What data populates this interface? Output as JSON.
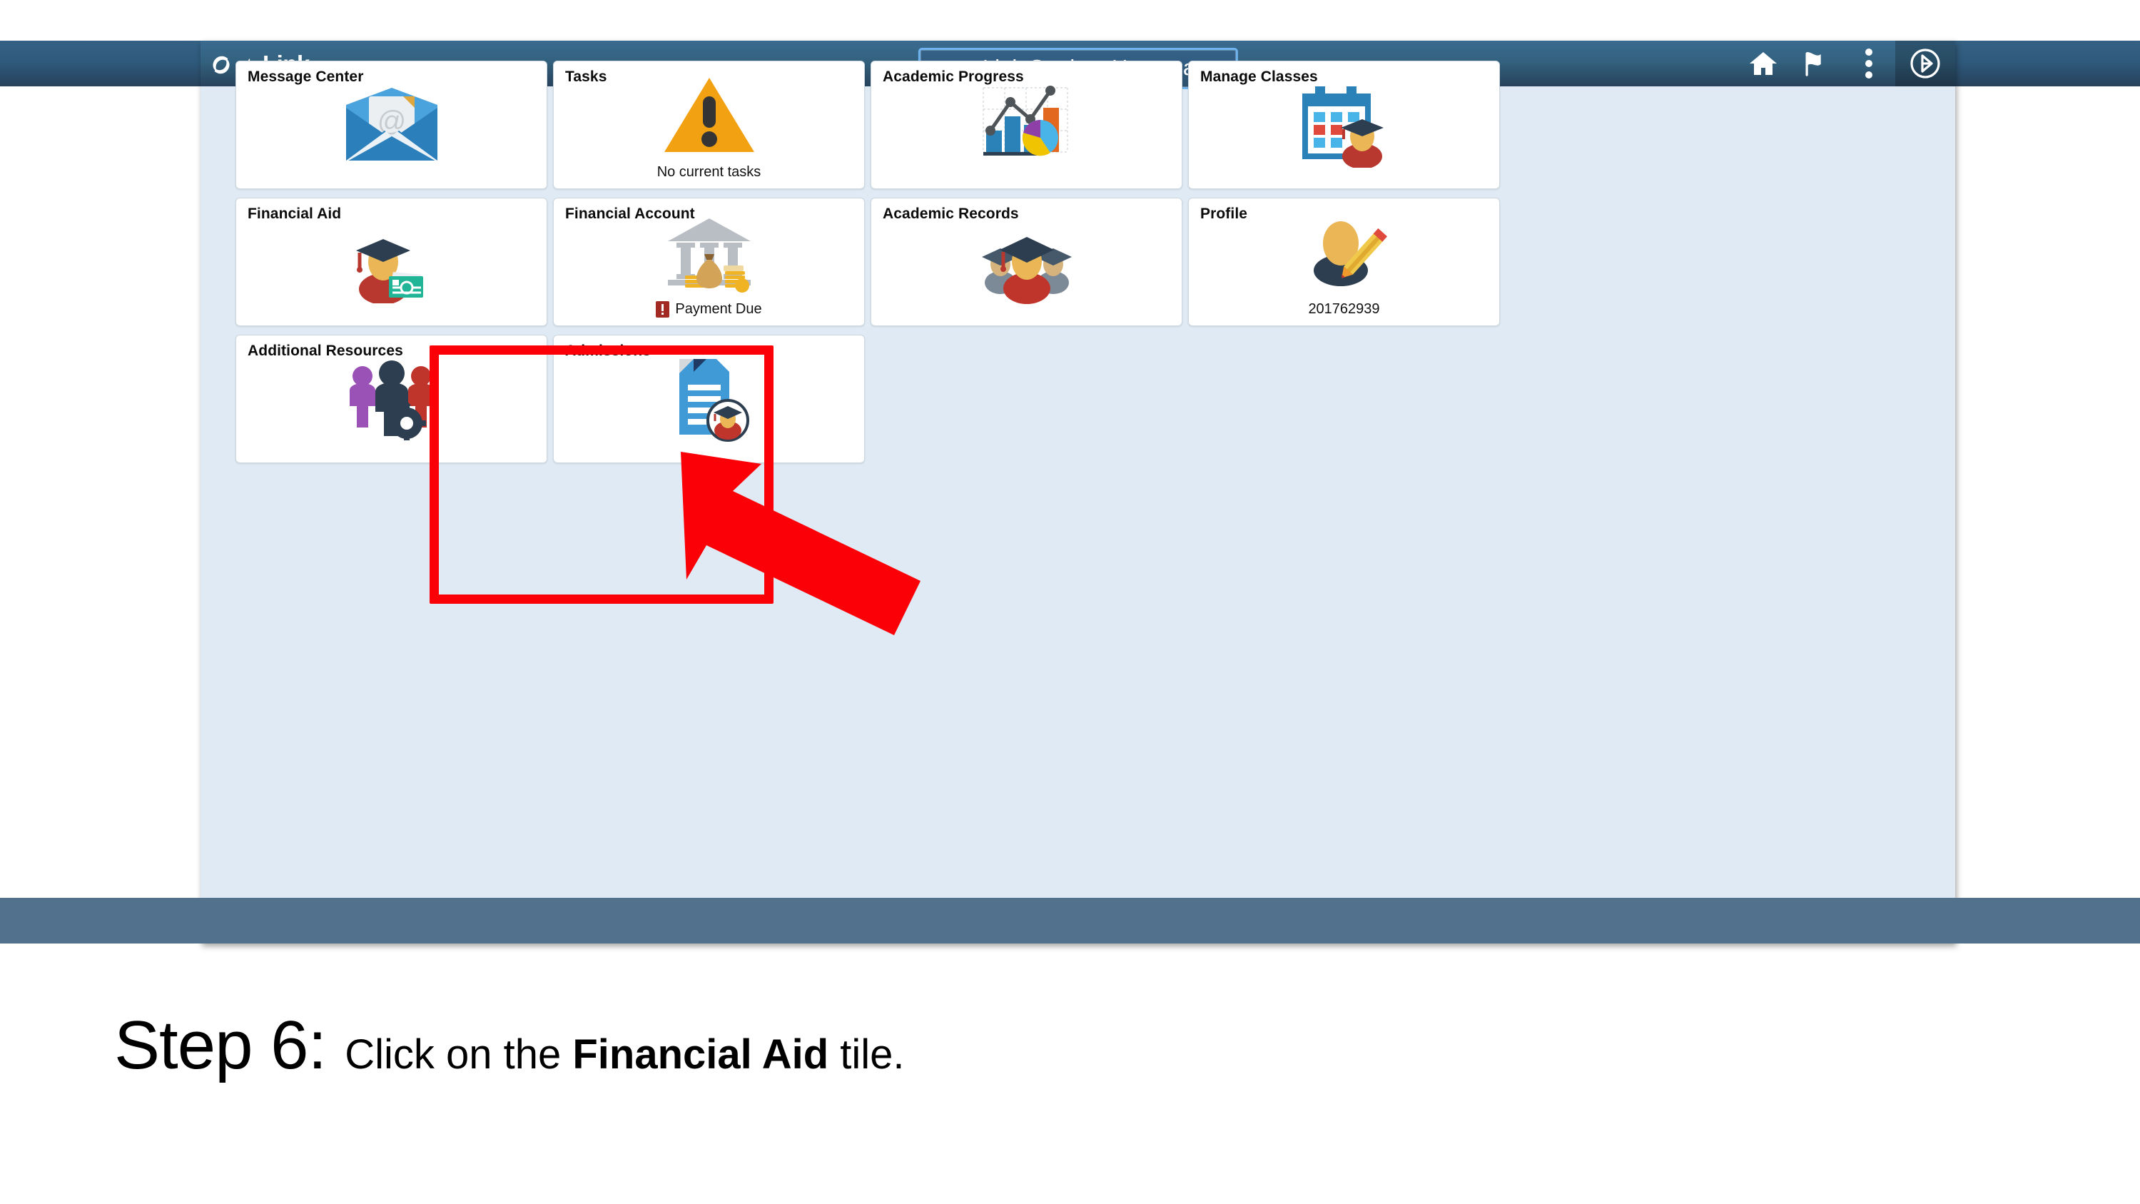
{
  "app": {
    "brand": {
      "text_prefix": "ctc",
      "text_suffix": "Link",
      "logo_icon": "ctclink-swirl-logo"
    },
    "title": "ctcLink Student Homepage",
    "title_caret_icon": "chevron-down-icon",
    "header_actions": [
      {
        "name": "home",
        "icon": "home-icon",
        "label": "Home"
      },
      {
        "name": "notifications",
        "icon": "flag-icon",
        "label": "Notifications"
      },
      {
        "name": "actions-menu",
        "icon": "kebab-menu-icon",
        "label": "Actions"
      },
      {
        "name": "nav-bar",
        "icon": "compass-navigator-icon",
        "label": "NavBar"
      }
    ]
  },
  "tiles": [
    {
      "title": "Message Center",
      "icon": "envelope-at-icon",
      "footer": "",
      "alert": false
    },
    {
      "title": "Tasks",
      "icon": "warning-triangle-icon",
      "footer": "No current tasks",
      "alert": false
    },
    {
      "title": "Academic Progress",
      "icon": "bar-line-pie-chart-icon",
      "footer": "",
      "alert": false
    },
    {
      "title": "Manage Classes",
      "icon": "calendar-graduate-icon",
      "footer": "",
      "alert": false
    },
    {
      "title": "Financial Aid",
      "icon": "graduate-money-icon",
      "footer": "",
      "alert": false
    },
    {
      "title": "Financial Account",
      "icon": "bank-moneybag-icon",
      "footer": "Payment Due",
      "alert": true
    },
    {
      "title": "Academic Records",
      "icon": "graduates-group-icon",
      "footer": "",
      "alert": false
    },
    {
      "title": "Profile",
      "icon": "person-pencil-icon",
      "footer": "201762939",
      "alert": false
    },
    {
      "title": "Additional Resources",
      "icon": "people-gear-icon",
      "footer": "",
      "alert": false
    },
    {
      "title": "Admissions",
      "icon": "document-graduate-icon",
      "footer": "",
      "alert": false
    }
  ],
  "footer": {
    "page_indicator_icon": "page-dot-indicator",
    "refresh_icon": "refresh-icon"
  },
  "annotation": {
    "highlight_target": "Financial Aid",
    "highlight_color": "#fb0007",
    "arrow_icon": "red-arrow-pointing-up-left",
    "caption_step": "Step 6:",
    "caption_before": "Click on the ",
    "caption_emphasis": "Financial Aid",
    "caption_after": " tile."
  }
}
